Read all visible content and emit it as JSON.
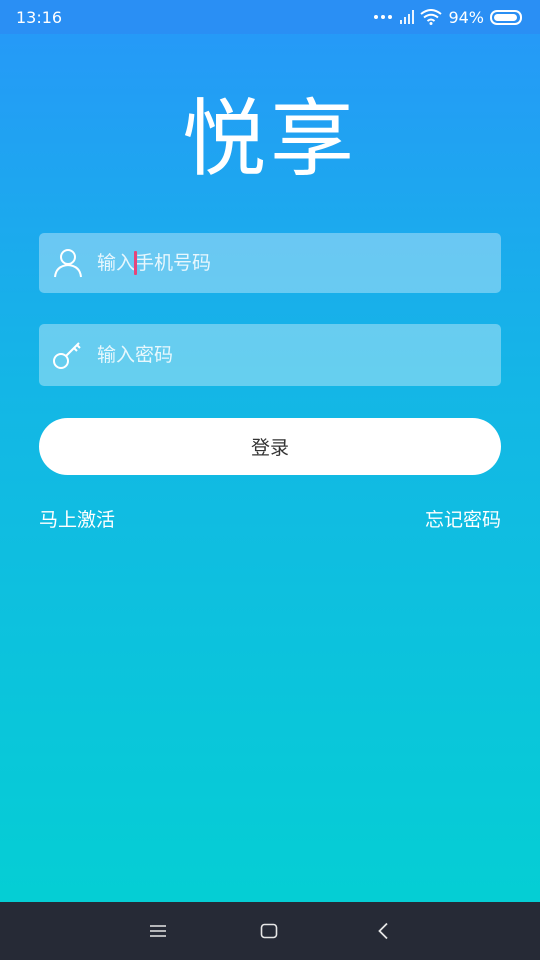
{
  "status_bar": {
    "time": "13:16",
    "battery_text": "94%",
    "battery_level": 0.94,
    "icons": [
      "more-dots-icon",
      "cell-signal-icon",
      "wifi-icon",
      "battery-icon"
    ]
  },
  "logo": {
    "text": "悦享"
  },
  "form": {
    "phone_placeholder": "输入手机号码",
    "phone_value": "",
    "phone_icon": "user-icon",
    "password_placeholder": "输入密码",
    "password_value": "",
    "password_icon": "key-icon",
    "login_label": "登录"
  },
  "links": {
    "activate": "马上激活",
    "forgot_password": "忘记密码"
  },
  "nav_bar": {
    "icons": [
      "menu-icon",
      "home-icon",
      "back-icon"
    ]
  },
  "colors": {
    "gradient_top": "#2797f9",
    "gradient_bottom": "#03d1d2",
    "status_bar": "#2a8ff4",
    "nav_bar": "#262a36",
    "caret": "#e6457a"
  }
}
